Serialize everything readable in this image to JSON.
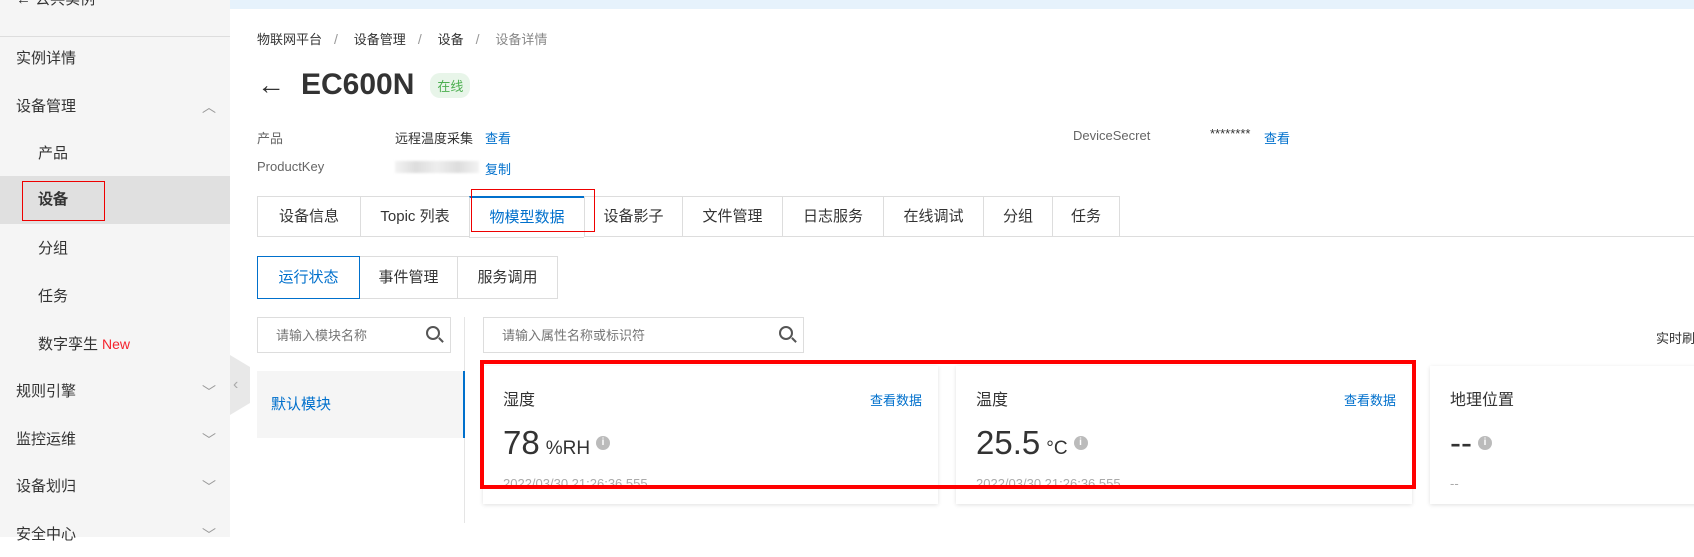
{
  "sidebar": {
    "back_label": "公共实例",
    "items": [
      {
        "label": "实例详情"
      },
      {
        "label": "设备管理"
      },
      {
        "label": "产品"
      },
      {
        "label": "设备"
      },
      {
        "label": "分组"
      },
      {
        "label": "任务"
      },
      {
        "label": "数字孪生",
        "badge": "New"
      },
      {
        "label": "规则引擎"
      },
      {
        "label": "监控运维"
      },
      {
        "label": "设备划归"
      },
      {
        "label": "安全中心"
      }
    ]
  },
  "breadcrumb": [
    "物联网平台",
    "设备管理",
    "设备",
    "设备详情"
  ],
  "device": {
    "name": "EC600N",
    "status": "在线",
    "product_label": "产品",
    "product_value": "远程温度采集",
    "product_link": "查看",
    "pk_label": "ProductKey",
    "pk_link": "复制",
    "secret_label": "DeviceSecret",
    "secret_value": "********",
    "secret_link": "查看"
  },
  "tabs": [
    "设备信息",
    "Topic 列表",
    "物模型数据",
    "设备影子",
    "文件管理",
    "日志服务",
    "在线调试",
    "分组",
    "任务"
  ],
  "subtabs": [
    "运行状态",
    "事件管理",
    "服务调用"
  ],
  "module_search": {
    "placeholder": "请输入模块名称"
  },
  "prop_search": {
    "placeholder": "请输入属性名称或标识符"
  },
  "module_item": "默认模块",
  "refresh_label": "实时刷",
  "cards": [
    {
      "title": "湿度",
      "link": "查看数据",
      "value": "78",
      "unit": "%RH",
      "time": "2022/03/30 21:26:36.555"
    },
    {
      "title": "温度",
      "link": "查看数据",
      "value": "25.5",
      "unit": "°C",
      "time": "2022/03/30 21:26:36.555"
    },
    {
      "title": "地理位置",
      "value": "--",
      "time": "--"
    }
  ]
}
